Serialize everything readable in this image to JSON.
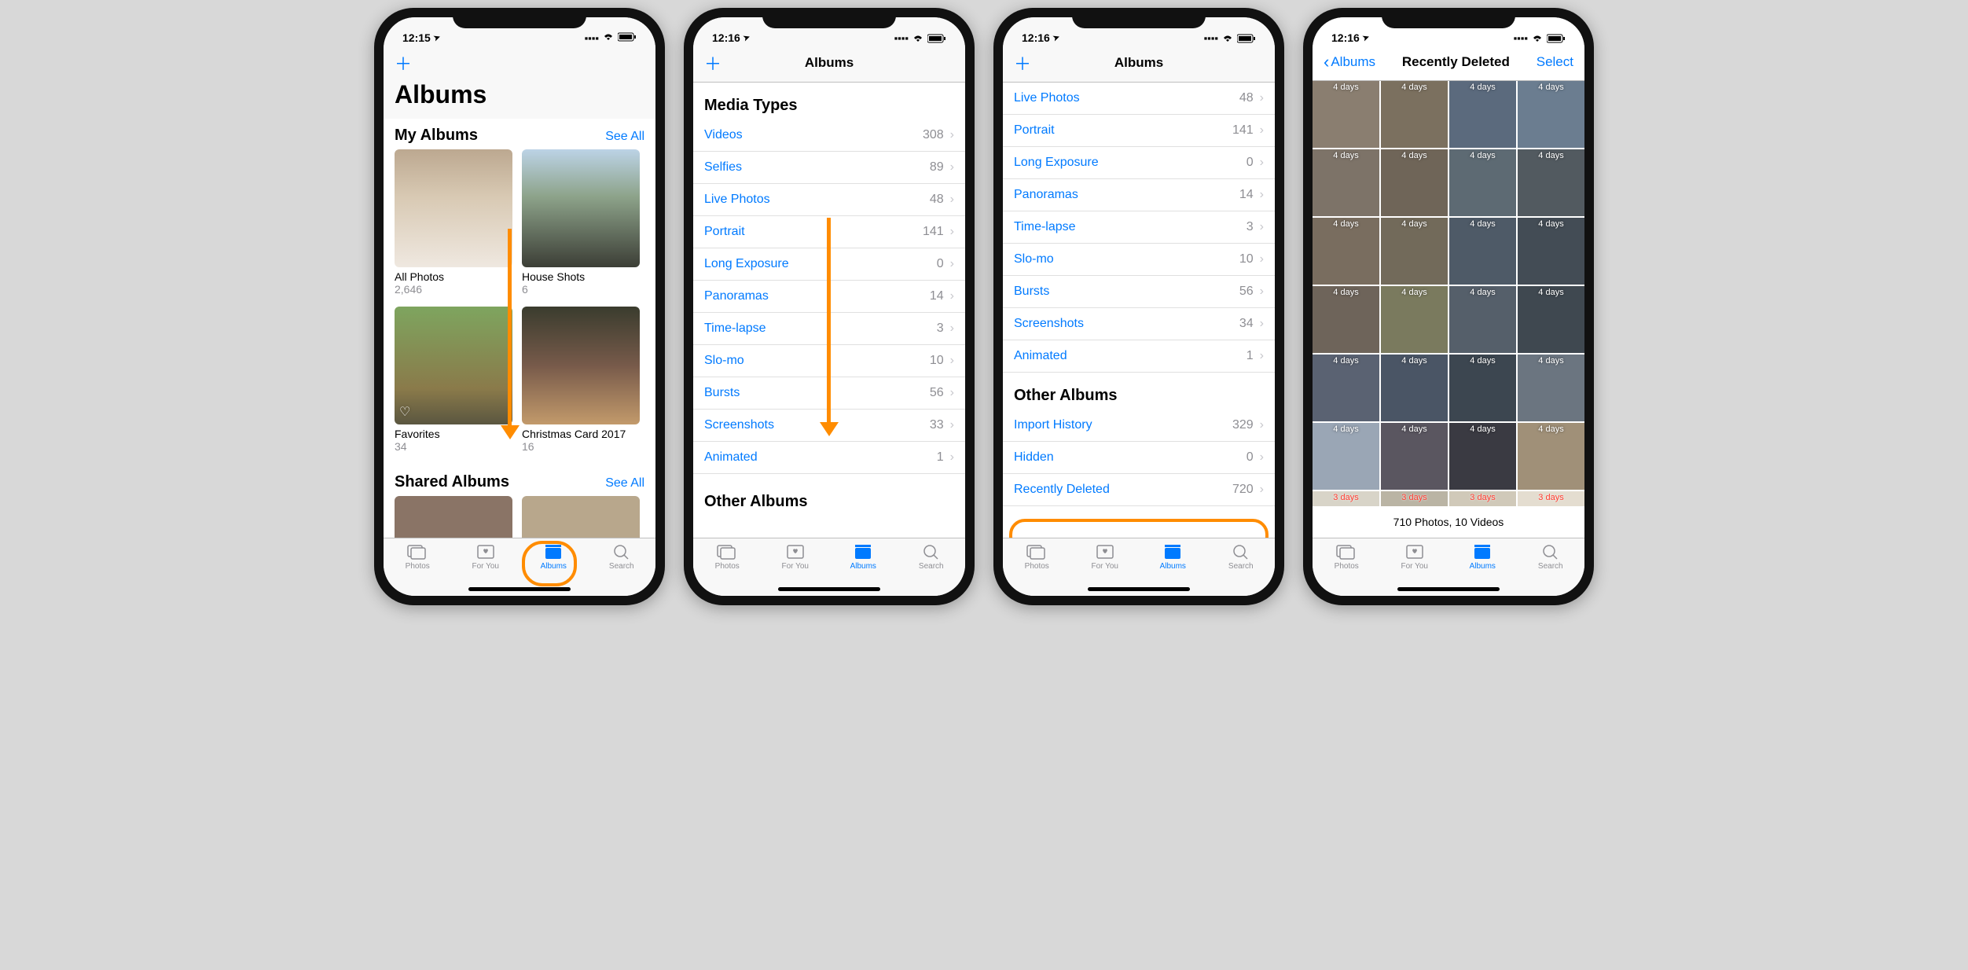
{
  "statusbar": {
    "time1": "12:15",
    "time2": "12:16",
    "location_icon": "➤"
  },
  "nav": {
    "add_icon": "＋",
    "albums_title": "Albums",
    "back_label": "Albums",
    "recently_deleted_title": "Recently Deleted",
    "select_label": "Select"
  },
  "largeTitle": "Albums",
  "myAlbums": {
    "header": "My Albums",
    "seeAll": "See All",
    "items": [
      {
        "label": "All Photos",
        "count": "2,646"
      },
      {
        "label": "House Shots",
        "count": "6"
      },
      {
        "label": "Favorites",
        "count": "34"
      },
      {
        "label": "Christmas Card 2017",
        "count": "16"
      }
    ]
  },
  "sharedAlbums": {
    "header": "Shared Albums",
    "seeAll": "See All"
  },
  "mediaTypesHeader": "Media Types",
  "otherAlbumsHeader": "Other Albums",
  "screen2_list": [
    {
      "name": "Videos",
      "count": "308"
    },
    {
      "name": "Selfies",
      "count": "89"
    },
    {
      "name": "Live Photos",
      "count": "48"
    },
    {
      "name": "Portrait",
      "count": "141"
    },
    {
      "name": "Long Exposure",
      "count": "0"
    },
    {
      "name": "Panoramas",
      "count": "14"
    },
    {
      "name": "Time-lapse",
      "count": "3"
    },
    {
      "name": "Slo-mo",
      "count": "10"
    },
    {
      "name": "Bursts",
      "count": "56"
    },
    {
      "name": "Screenshots",
      "count": "33"
    },
    {
      "name": "Animated",
      "count": "1"
    }
  ],
  "screen3_media": [
    {
      "name": "Live Photos",
      "count": "48"
    },
    {
      "name": "Portrait",
      "count": "141"
    },
    {
      "name": "Long Exposure",
      "count": "0"
    },
    {
      "name": "Panoramas",
      "count": "14"
    },
    {
      "name": "Time-lapse",
      "count": "3"
    },
    {
      "name": "Slo-mo",
      "count": "10"
    },
    {
      "name": "Bursts",
      "count": "56"
    },
    {
      "name": "Screenshots",
      "count": "34"
    },
    {
      "name": "Animated",
      "count": "1"
    }
  ],
  "screen3_other": [
    {
      "name": "Import History",
      "count": "329"
    },
    {
      "name": "Hidden",
      "count": "0"
    },
    {
      "name": "Recently Deleted",
      "count": "720"
    }
  ],
  "tabs": {
    "photos": "Photos",
    "foryou": "For You",
    "albums": "Albums",
    "search": "Search"
  },
  "deleted": {
    "footer": "710 Photos, 10 Videos",
    "day4": "4 days",
    "day3": "3 days"
  },
  "thumb_colors": [
    "#8a7e70",
    "#7b705f",
    "#5b6a7d",
    "#6b7d90",
    "#7d7368",
    "#6f6558",
    "#5d6a73",
    "#525a60",
    "#796d5f",
    "#726a5a",
    "#4e5a67",
    "#434c55",
    "#6e645a",
    "#7a7a5e",
    "#555f6a",
    "#3f4850",
    "#5a6272",
    "#4a5565",
    "#3c4650",
    "#6b7580",
    "#9aa6b5",
    "#5a5660",
    "#3a3a42",
    "#a09078",
    "#d8d4c8",
    "#bab4a4",
    "#d0c9b9",
    "#e4ddd0",
    "#c8c2b2",
    "#5a4a3e",
    "#4a3e34",
    "#dcd8cc"
  ]
}
